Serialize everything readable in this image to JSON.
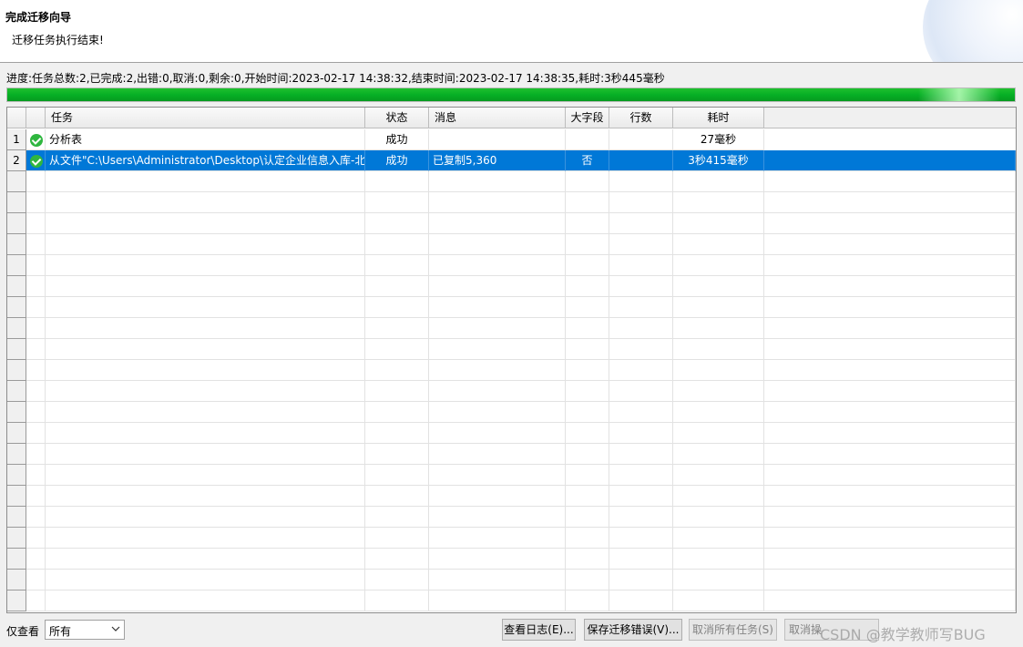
{
  "header": {
    "title": "完成迁移向导",
    "subtitle": "迁移任务执行结束!"
  },
  "progress": {
    "text": "进度:任务总数:2,已完成:2,出错:0,取消:0,剩余:0,开始时间:2023-02-17 14:38:32,结束时间:2023-02-17 14:38:35,耗时:3秒445毫秒",
    "fraction": 1.0,
    "color": "#06b025"
  },
  "table": {
    "columns": [
      "任务",
      "状态",
      "消息",
      "大字段",
      "行数",
      "耗时"
    ],
    "rows": [
      {
        "num": "1",
        "task": "分析表",
        "status": "成功",
        "message": "",
        "bigfield": "",
        "rowcount": "",
        "time": "27毫秒",
        "icon": "success-check-icon"
      },
      {
        "num": "2",
        "task": "从文件\"C:\\Users\\Administrator\\Desktop\\认定企业信息入库-北",
        "status": "成功",
        "message": "已复制5,360",
        "bigfield": "否",
        "rowcount": "",
        "time": "3秒415毫秒",
        "icon": "success-check-icon",
        "selected": true
      }
    ],
    "selection_color": "#0078d7"
  },
  "footer": {
    "filter_label": "仅查看",
    "filter_value": "所有",
    "buttons": {
      "view_log": "查看日志(E)...",
      "save_errors": "保存迁移错误(V)...",
      "cancel_all": "取消所有任务(S)",
      "cancel": "取消操"
    },
    "watermark": "CSDN @教学教师写BUG"
  }
}
